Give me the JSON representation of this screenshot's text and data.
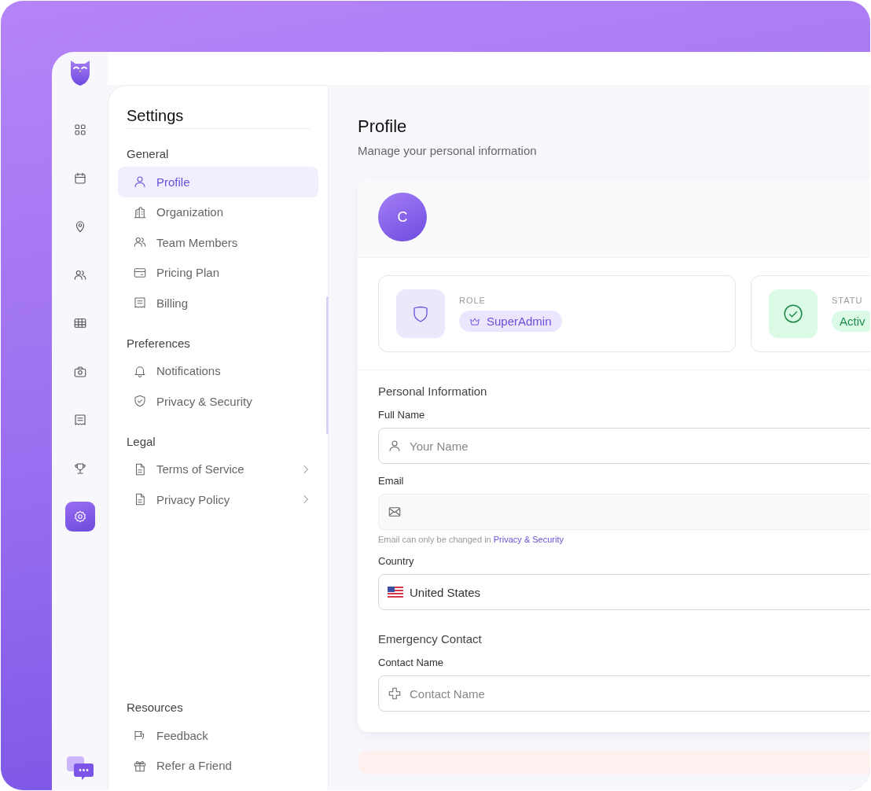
{
  "rail": {
    "items": [
      {
        "selected": false
      },
      {
        "selected": false
      },
      {
        "selected": false
      },
      {
        "selected": false
      },
      {
        "selected": false
      },
      {
        "selected": false
      },
      {
        "selected": false
      },
      {
        "selected": false
      },
      {
        "selected": true
      }
    ]
  },
  "settings": {
    "title": "Settings",
    "groups": [
      {
        "title": "General",
        "items": [
          {
            "label": "Profile",
            "selected": true,
            "chevron": false
          },
          {
            "label": "Organization",
            "selected": false,
            "chevron": false
          },
          {
            "label": "Team Members",
            "selected": false,
            "chevron": false
          },
          {
            "label": "Pricing Plan",
            "selected": false,
            "chevron": false
          },
          {
            "label": "Billing",
            "selected": false,
            "chevron": false
          }
        ]
      },
      {
        "title": "Preferences",
        "items": [
          {
            "label": "Notifications",
            "selected": false,
            "chevron": false
          },
          {
            "label": "Privacy & Security",
            "selected": false,
            "chevron": false
          }
        ]
      },
      {
        "title": "Legal",
        "items": [
          {
            "label": "Terms of Service",
            "selected": false,
            "chevron": true
          },
          {
            "label": "Privacy Policy",
            "selected": false,
            "chevron": true
          }
        ]
      },
      {
        "title": "Resources",
        "items": [
          {
            "label": "Feedback",
            "selected": false,
            "chevron": false
          },
          {
            "label": "Refer a Friend",
            "selected": false,
            "chevron": false
          }
        ]
      }
    ]
  },
  "page": {
    "title": "Profile",
    "subtitle": "Manage your personal information"
  },
  "profile": {
    "avatar": "C",
    "badges": [
      {
        "kind": "role",
        "label": "ROLE",
        "value": "SuperAdmin"
      },
      {
        "kind": "status",
        "label": "STATU",
        "value": "Activ"
      }
    ],
    "sections": [
      {
        "title": "Personal Information",
        "fields": [
          {
            "kind": "text",
            "label": "Full Name",
            "placeholder": "Your Name",
            "disabled": false
          },
          {
            "kind": "email",
            "label": "Email",
            "disabled": true,
            "hint": "Email can only be changed in ",
            "hint_link": "Privacy & Security"
          },
          {
            "kind": "country",
            "label": "Country",
            "value": "United States",
            "disabled": false
          }
        ]
      },
      {
        "title": "Emergency Contact",
        "fields": [
          {
            "kind": "contact",
            "label": "Contact Name",
            "placeholder": "Contact Name",
            "disabled": false
          }
        ]
      }
    ]
  }
}
